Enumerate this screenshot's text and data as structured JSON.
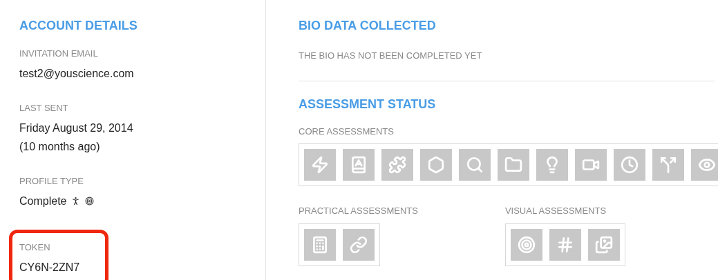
{
  "account": {
    "heading": "ACCOUNT DETAILS",
    "fields": [
      {
        "label": "INVITATION EMAIL",
        "lines": [
          "test2@youscience.com"
        ]
      },
      {
        "label": "LAST SENT",
        "lines": [
          "Friday August 29, 2014",
          "(10 months ago)"
        ]
      },
      {
        "label": "PROFILE TYPE",
        "lines": [
          "Complete"
        ],
        "kind": "profile"
      },
      {
        "label": "TOKEN",
        "lines": [
          "CY6N-2ZN7"
        ],
        "highlighted": true
      }
    ]
  },
  "bio": {
    "heading": "BIO DATA COLLECTED",
    "text": "THE BIO HAS NOT BEEN COMPLETED YET"
  },
  "assessment": {
    "heading": "ASSESSMENT STATUS",
    "groups": [
      {
        "label": "CORE ASSESSMENTS",
        "kind": "core"
      },
      {
        "label": "PRACTICAL ASSESSMENTS",
        "kind": "practical"
      },
      {
        "label": "VISUAL ASSESSMENTS",
        "kind": "visual"
      }
    ]
  }
}
